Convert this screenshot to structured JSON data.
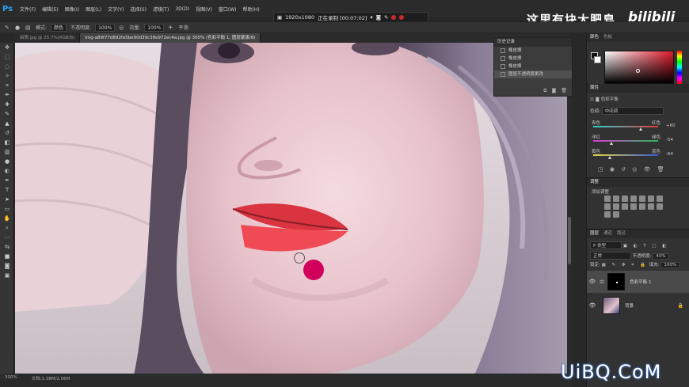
{
  "app": {
    "logo": "Ps"
  },
  "menu": [
    "文件(F)",
    "编辑(E)",
    "图像(I)",
    "图层(L)",
    "文字(Y)",
    "选择(S)",
    "滤镜(T)",
    "3D(D)",
    "视图(V)",
    "窗口(W)",
    "帮助(H)"
  ],
  "recorder": {
    "resolution": "1920x1080",
    "status": "正在录制 [00:07:02]"
  },
  "channel": {
    "title": "这里有块大肥皂",
    "brand": "bilibili"
  },
  "options": {
    "mode_label": "模式:",
    "mode_value": "颜色",
    "opacity_label": "不透明度:",
    "opacity_value": "100%",
    "flow_label": "流量:",
    "flow_value": "100%",
    "smooth_label": "平滑:"
  },
  "tabs": [
    {
      "label": "拍照.jpg @ 25.7%(RGB/8)",
      "active": false
    },
    {
      "label": "img-a89f77d892fa5be90d39c38e972ec4a.jpg @ 300% (色彩平衡 1, 图层蒙版/8)",
      "active": true
    }
  ],
  "history": {
    "title": "历史记录",
    "items": [
      {
        "label": "橡皮擦",
        "active": false
      },
      {
        "label": "橡皮擦",
        "active": false
      },
      {
        "label": "橡皮擦",
        "active": false
      },
      {
        "label": "图层不透明度更改",
        "active": true
      }
    ]
  },
  "color_panel": {
    "tabs": [
      "颜色",
      "色板"
    ],
    "fg": "#111111",
    "bg": "#ffffff"
  },
  "properties": {
    "title": "属性",
    "adjustment": "色彩平衡",
    "tone_label": "色调:",
    "tone_value": "中间调",
    "sliders": [
      {
        "left": "青色",
        "right": "红色",
        "value": "+60",
        "position": 0.73,
        "color": "#e23a3a"
      },
      {
        "left": "洋红",
        "right": "绿色",
        "value": "-54",
        "position": 0.28,
        "color": "#2fb65a"
      },
      {
        "left": "黄色",
        "right": "蓝色",
        "value": "-64",
        "position": 0.25,
        "color": "#3957d6"
      }
    ]
  },
  "adjustments": {
    "title": "调整",
    "subtitle": "添加调整"
  },
  "layers": {
    "tabs": [
      "图层",
      "通道",
      "路径"
    ],
    "kind_label": "P 类型",
    "blend_mode": "正常",
    "opacity_label": "不透明度:",
    "opacity_value": "40%",
    "lock_label": "锁定:",
    "fill_label": "填充:",
    "fill_value": "100%",
    "items": [
      {
        "name": "色彩平衡 1",
        "active": true
      },
      {
        "name": "背景",
        "active": false
      }
    ]
  },
  "status": {
    "zoom": "300%",
    "doc": "文档:1.38M/2.06M"
  },
  "watermark": "UiBQ.CoM"
}
